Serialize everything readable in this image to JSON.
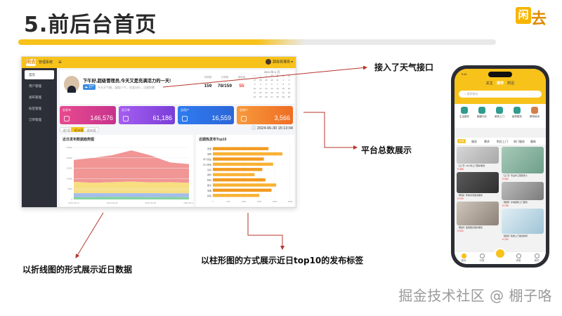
{
  "slide": {
    "title": "5.前后台首页",
    "logo_text_a": "闲",
    "logo_text_b": "去"
  },
  "admin": {
    "logo": "闲去",
    "system_name": "管理系统",
    "menu_icon": "≡",
    "user": "超级管理员",
    "sidebar": [
      "首页",
      "用户管理",
      "发布管理",
      "标签管理",
      "订单管理"
    ],
    "welcome": {
      "greeting": "下午好,超级管理员,今天又是充满活力的一天!",
      "temperature": "27°",
      "sub": "今天天气晴，温度27℃，适宜出行，注意防晒"
    },
    "stats": [
      {
        "label": "待审核",
        "value": "159",
        "color": "#222222"
      },
      {
        "label": "已审核",
        "value": "78/159",
        "color": "#222222"
      },
      {
        "label": "被拒绝",
        "value": "55",
        "color": "#e53935"
      }
    ],
    "calendar": {
      "title": "2024 年 6 月",
      "weekdays": [
        "一",
        "二",
        "三",
        "四",
        "五",
        "六",
        "日"
      ],
      "days": [
        "27",
        "28",
        "29",
        "30",
        "31",
        "1",
        "2",
        "3",
        "4",
        "5",
        "6",
        "7",
        "8",
        "9",
        "10",
        "11",
        "12",
        "13",
        "14",
        "15",
        "16",
        "17",
        "18",
        "19",
        "20",
        "21",
        "22",
        "23",
        "24",
        "25",
        "26",
        "27",
        "28",
        "29",
        "30"
      ]
    },
    "cards": [
      {
        "label": "总发布",
        "value": "146,576",
        "from": "#e84a8f",
        "to": "#c7338c"
      },
      {
        "label": "总订单",
        "value": "61,186",
        "from": "#a55ef0",
        "to": "#7a3ed8"
      },
      {
        "label": "总用户",
        "value": "16,559",
        "from": "#2f7cf0",
        "to": "#2b66d8"
      },
      {
        "label": "总商户",
        "value": "3,566",
        "from": "#f79a3c",
        "to": "#ef6d24"
      }
    ],
    "tabs": [
      "近7日",
      "近15日",
      "近30日"
    ],
    "active_tab": 1,
    "clock": "2024-06-30 15:13:04",
    "area_chart_title": "近日发布数据趋势图",
    "bar_chart_title": "近期热发布Top10"
  },
  "chart_data": [
    {
      "type": "area",
      "title": "近日发布数据趋势图",
      "legend": [
        "",
        "",
        "",
        ""
      ],
      "x": [
        "2024-06-24",
        "2024-06-25",
        "2024-06-26",
        "2024-06-27",
        "2024-06-28",
        "2024-06-29",
        "2024-06-30"
      ],
      "ylim": [
        0,
        25000
      ],
      "series": [
        {
          "name": "",
          "color": "#7fd19c",
          "values": [
            1200,
            1100,
            1300,
            1200,
            1100,
            1200,
            1100
          ]
        },
        {
          "name": "",
          "color": "#9fb9ea",
          "values": [
            1800,
            1900,
            1700,
            1800,
            1900,
            1700,
            1800
          ]
        },
        {
          "name": "",
          "color": "#f7dc7a",
          "values": [
            5500,
            5000,
            5300,
            5600,
            5200,
            5400,
            5100
          ]
        },
        {
          "name": "",
          "color": "#f08f8f",
          "values": [
            10500,
            12000,
            13000,
            15000,
            13000,
            9500,
            9000
          ]
        }
      ]
    },
    {
      "type": "bar",
      "orientation": "horizontal",
      "title": "近期热发布Top10",
      "categories": [
        "家居",
        "宠物",
        "学习用品",
        "办公用品",
        "运动",
        "服饰",
        "数码",
        "图书",
        "电器",
        "其他"
      ],
      "xlim": [
        0,
        2500
      ],
      "values": [
        1800,
        2250,
        1650,
        1950,
        1600,
        1350,
        1700,
        2050,
        1900,
        1500
      ]
    }
  ],
  "annotations": {
    "weather": "接入了天气接口",
    "totals": "平台总数展示",
    "line_chart": "以折线图的形式展示近日数据",
    "bar_chart": "以柱形图的方式展示近日top10的发布标签"
  },
  "phone": {
    "time": "9:41",
    "tabs": [
      "关注",
      "推荐",
      "附近"
    ],
    "active_tab": 1,
    "search_placeholder": "搜索服务",
    "categories": [
      "生活服务",
      "跑腿代办",
      "家政上门",
      "维修服务",
      "教育培训"
    ],
    "sub_tabs": [
      "推荐",
      "附近",
      "热门"
    ],
    "filters": [
      "全部",
      "服务",
      "需求",
      "附近上门",
      "热门服务",
      "最新"
    ],
    "active_filter": 0,
    "feed": [
      {
        "text": "【上门】24小时上门陪护服务",
        "price": "¥ 888"
      },
      {
        "text": "【上门】专业护工照顾老人",
        "price": "¥ 680"
      },
      {
        "text": "【家政】家电清洗保洁服务",
        "price": "¥ 299"
      },
      {
        "text": "【维修】水电维修上门服务",
        "price": "¥ 158"
      },
      {
        "text": "【陪护】医院陪诊陪护服务",
        "price": "¥ 520"
      },
      {
        "text": "【健身】私教上门健身指导",
        "price": "¥ 300"
      }
    ],
    "nav": [
      "首页",
      "分类",
      "",
      "消息",
      "我的"
    ]
  },
  "watermark": "掘金技术社区 @ 棚子咯"
}
